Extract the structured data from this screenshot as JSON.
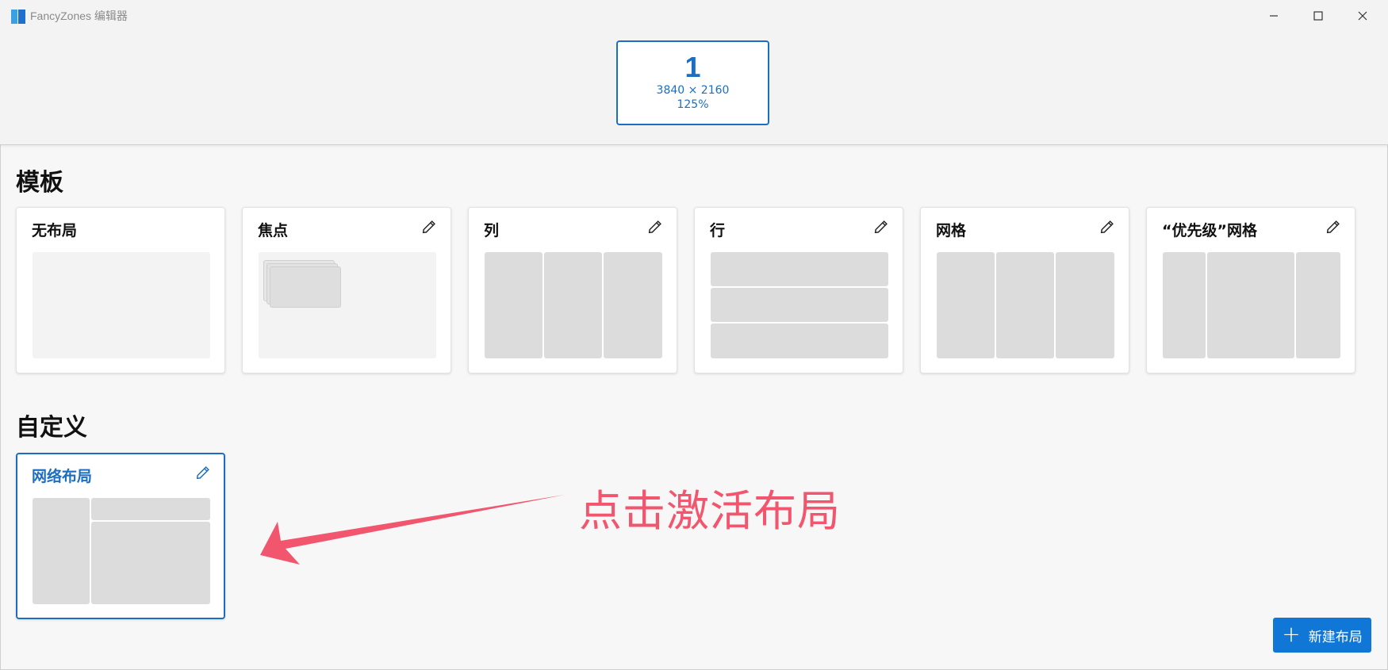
{
  "window": {
    "title": "FancyZones 编辑器"
  },
  "monitor": {
    "number": "1",
    "resolution": "3840 × 2160",
    "scale": "125%"
  },
  "templates": {
    "heading": "模板",
    "items": [
      {
        "label": "无布局",
        "editable": false
      },
      {
        "label": "焦点",
        "editable": true
      },
      {
        "label": "列",
        "editable": true
      },
      {
        "label": "行",
        "editable": true
      },
      {
        "label": "网格",
        "editable": true
      },
      {
        "label": "“优先级”网格",
        "editable": true
      }
    ]
  },
  "custom": {
    "heading": "自定义",
    "items": [
      {
        "label": "网络布局",
        "editable": true,
        "selected": true
      }
    ]
  },
  "annotation": {
    "text": "点击激活布局",
    "color": "#f2566e"
  },
  "actions": {
    "new_layout_label": "新建布局",
    "accent": "#1177d7"
  }
}
